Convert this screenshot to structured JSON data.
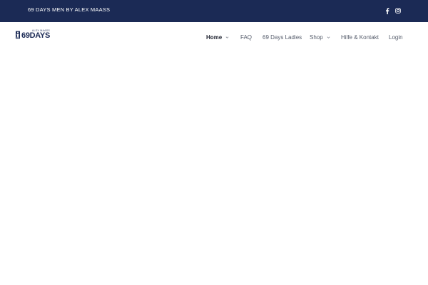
{
  "topbar": {
    "tagline": "69 DAYS MEN BY ALEX MAASS",
    "social": [
      {
        "icon": "facebook-icon"
      },
      {
        "icon": "instagram-icon"
      }
    ],
    "colors": {
      "background": "#1b2a55",
      "text": "#ffffff"
    }
  },
  "header": {
    "logo": {
      "small_text": "ALEX MAASS",
      "big_text": "69DAYS"
    },
    "nav": [
      {
        "label": "Home",
        "active": true,
        "has_dropdown": true
      },
      {
        "label": "FAQ",
        "active": false,
        "has_dropdown": false
      },
      {
        "label": "69 Days Ladies",
        "active": false,
        "has_dropdown": false
      },
      {
        "label": "Shop",
        "active": false,
        "has_dropdown": true
      },
      {
        "label": "Hilfe & Kontakt",
        "active": false,
        "has_dropdown": false
      },
      {
        "label": "Login",
        "active": false,
        "has_dropdown": false
      }
    ]
  }
}
